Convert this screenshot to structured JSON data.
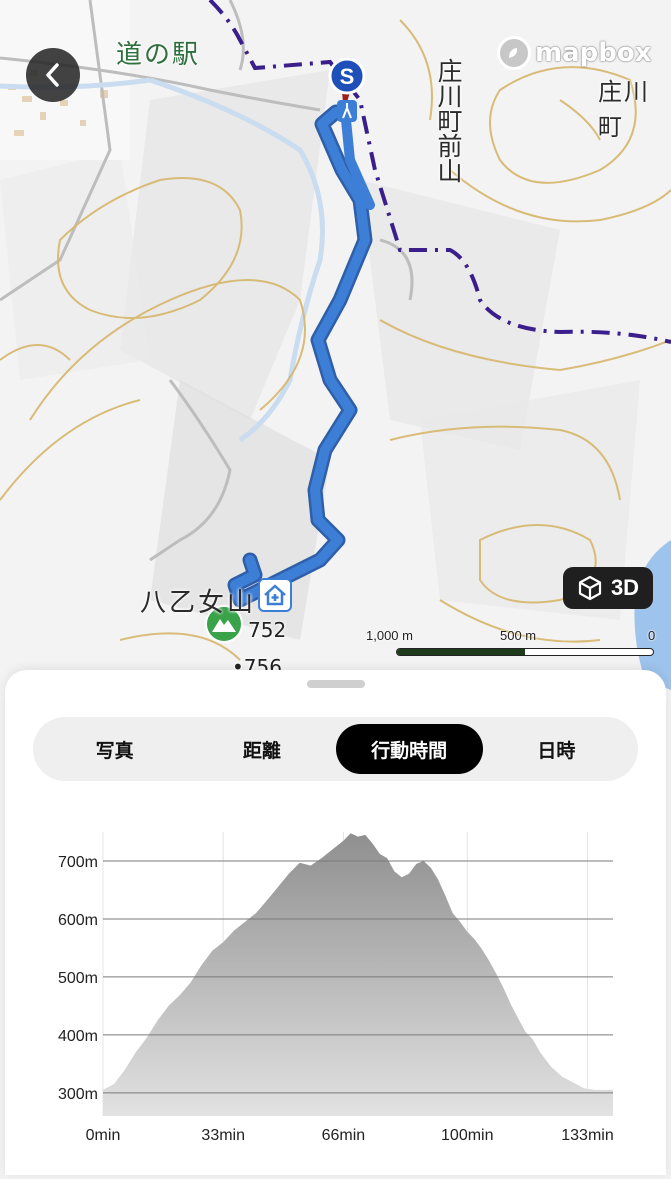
{
  "map": {
    "labels": {
      "station": "道の駅",
      "mountain": "庄川町前山",
      "town": "庄川町",
      "peak": "八乙女山",
      "elev1": "752",
      "elev2": "756"
    },
    "start_marker": "S",
    "brand": "mapbox",
    "btn_3d": "3D",
    "scale": {
      "left": "1,000 m",
      "mid": "500 m",
      "right": "0"
    },
    "icons": {
      "back": "chevron-left-icon",
      "mapbox": "mapbox-logo-icon",
      "cube": "cube-icon",
      "hut": "hut-icon",
      "summit": "mountain-icon"
    },
    "colors": {
      "route": "#3d7fd6",
      "boundary": "#3a1f8c",
      "contour": "#d6b66a",
      "accent": "#000000"
    }
  },
  "sheet": {
    "tabs": [
      {
        "label": "写真",
        "active": false
      },
      {
        "label": "距離",
        "active": false
      },
      {
        "label": "行動時間",
        "active": true
      },
      {
        "label": "日時",
        "active": false
      }
    ]
  },
  "chart_data": {
    "type": "area",
    "title": "",
    "xlabel": "",
    "ylabel": "",
    "x_ticks": [
      "0min",
      "33min",
      "66min",
      "100min",
      "133min"
    ],
    "y_ticks": [
      "300m",
      "400m",
      "500m",
      "600m",
      "700m"
    ],
    "ylim": [
      260,
      750
    ],
    "xlim": [
      0,
      140
    ],
    "grid": true,
    "series": [
      {
        "x": [
          0,
          3,
          6,
          9,
          12,
          15,
          18,
          21,
          24,
          27,
          30,
          33,
          36,
          39,
          42,
          45,
          48,
          51,
          54,
          57,
          60,
          63,
          66,
          68,
          70,
          72,
          74,
          76,
          78,
          80,
          82,
          84,
          86,
          88,
          90,
          92,
          94,
          96,
          98,
          100,
          102,
          104,
          106,
          108,
          110,
          112,
          114,
          116,
          118,
          120,
          123,
          126,
          129,
          132,
          135,
          138,
          140
        ],
        "y": [
          305,
          315,
          340,
          370,
          395,
          425,
          450,
          468,
          490,
          520,
          545,
          560,
          580,
          595,
          610,
          632,
          655,
          678,
          697,
          692,
          705,
          720,
          735,
          748,
          742,
          745,
          730,
          712,
          705,
          682,
          672,
          678,
          695,
          700,
          688,
          668,
          640,
          610,
          595,
          578,
          565,
          548,
          528,
          505,
          480,
          452,
          428,
          405,
          392,
          370,
          345,
          328,
          318,
          308,
          305,
          305,
          305
        ]
      }
    ]
  }
}
